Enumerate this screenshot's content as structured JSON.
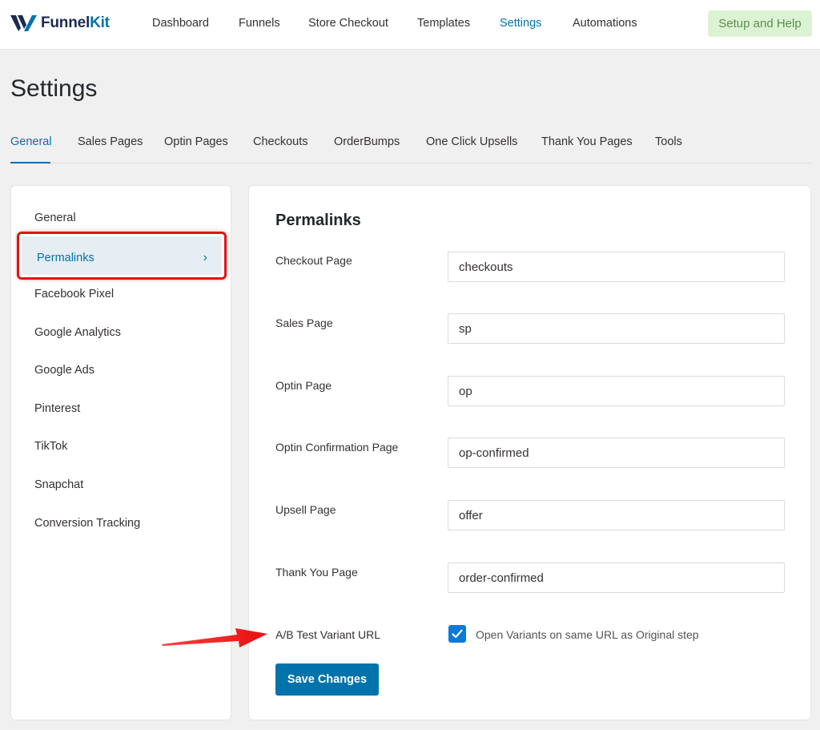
{
  "brand": {
    "name_part1": "Funnel",
    "name_part2": "Kit",
    "color": "#1d2b52",
    "accent": "#0073aa"
  },
  "topnav": {
    "items": [
      {
        "label": "Dashboard",
        "active": false
      },
      {
        "label": "Funnels",
        "active": false
      },
      {
        "label": "Store Checkout",
        "active": false
      },
      {
        "label": "Templates",
        "active": false
      },
      {
        "label": "Settings",
        "active": true
      },
      {
        "label": "Automations",
        "active": false
      }
    ],
    "help_button": "Setup and Help"
  },
  "page_title": "Settings",
  "tabs": [
    {
      "label": "General",
      "active": true
    },
    {
      "label": "Sales Pages",
      "active": false
    },
    {
      "label": "Optin Pages",
      "active": false
    },
    {
      "label": "Checkouts",
      "active": false
    },
    {
      "label": "OrderBumps",
      "active": false
    },
    {
      "label": "One Click Upsells",
      "active": false
    },
    {
      "label": "Thank You Pages",
      "active": false
    },
    {
      "label": "Tools",
      "active": false
    }
  ],
  "sidebar": {
    "items": [
      {
        "label": "General"
      },
      {
        "label": "Permalinks",
        "active": true
      },
      {
        "label": "Facebook Pixel"
      },
      {
        "label": "Google Analytics"
      },
      {
        "label": "Google Ads"
      },
      {
        "label": "Pinterest"
      },
      {
        "label": "TikTok"
      },
      {
        "label": "Snapchat"
      },
      {
        "label": "Conversion Tracking"
      }
    ],
    "active_chevron": "›"
  },
  "permalinks": {
    "title": "Permalinks",
    "fields": [
      {
        "label": "Checkout Page",
        "value": "checkouts"
      },
      {
        "label": "Sales Page",
        "value": "sp"
      },
      {
        "label": "Optin Page",
        "value": "op"
      },
      {
        "label": "Optin Confirmation Page",
        "value": "op-confirmed"
      },
      {
        "label": "Upsell Page",
        "value": "offer"
      },
      {
        "label": "Thank You Page",
        "value": "order-confirmed"
      }
    ],
    "ab_test": {
      "label": "A/B Test Variant URL",
      "checkbox_label": "Open Variants on same URL as Original step",
      "checked": true
    },
    "save_button": "Save Changes"
  },
  "colors": {
    "active_blue": "#0073aa",
    "highlight_red": "#e01414",
    "help_bg": "#dcf3d3",
    "checkbox_blue": "#0c7bd8"
  },
  "icons": {
    "check": "check-icon",
    "chevron": "chevron-right-icon",
    "arrow": "red-arrow-icon"
  }
}
